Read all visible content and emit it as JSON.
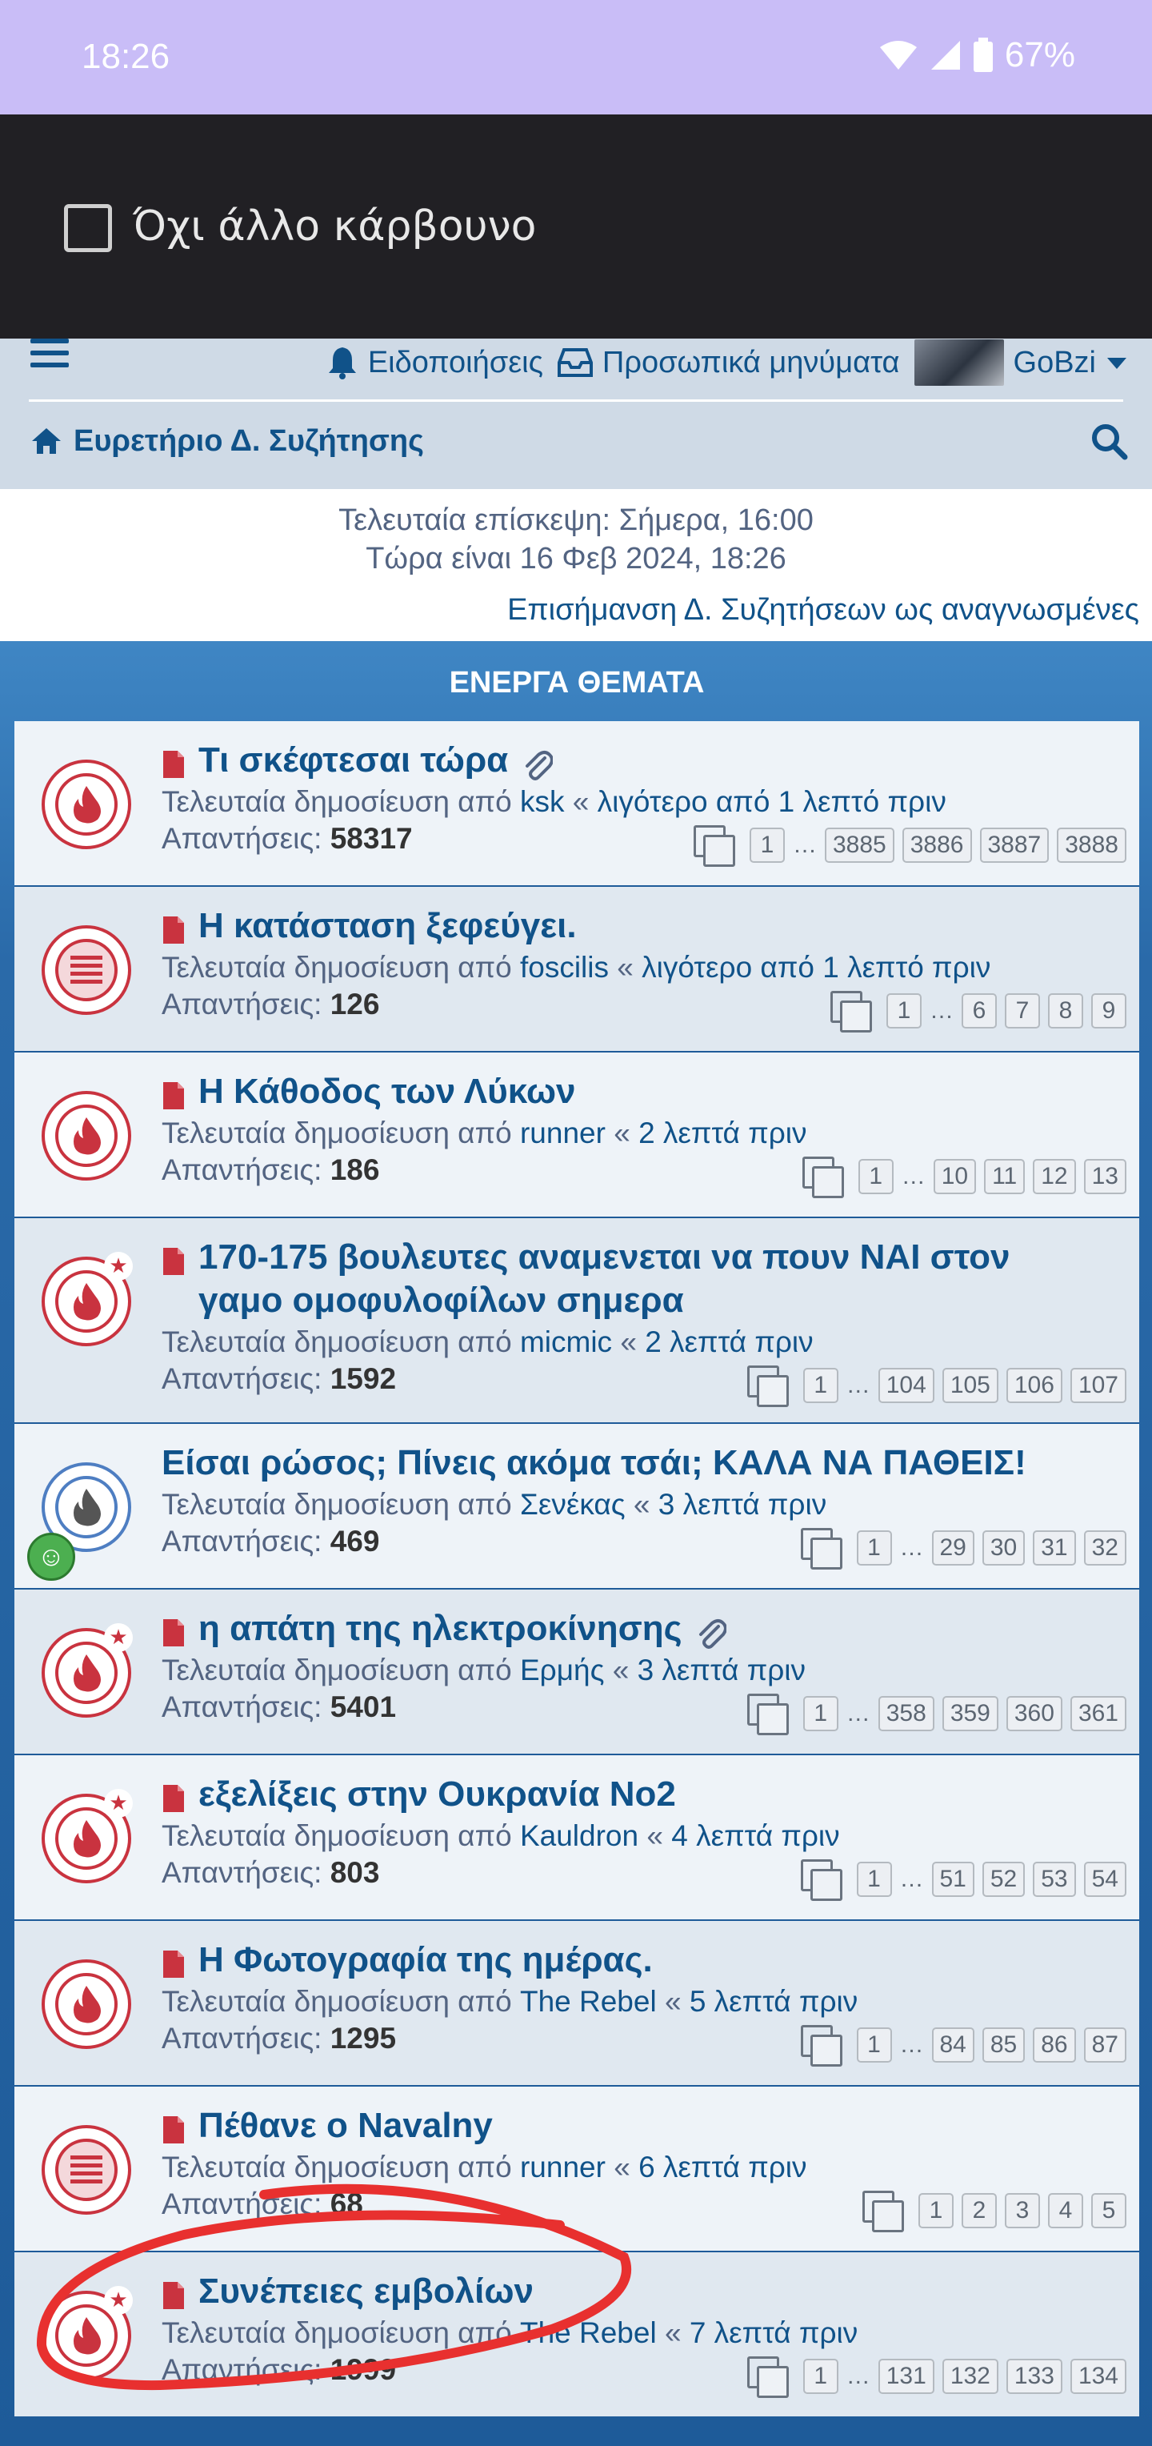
{
  "status_bar": {
    "time": "18:26",
    "battery": "67%",
    "icons": [
      "wifi-icon",
      "signal-icon",
      "battery-icon"
    ]
  },
  "top_banner": {
    "checkbox_label": "Όχι άλλο κάρβουνο",
    "checked": false
  },
  "nav": {
    "notifications": "Ειδοποιήσεις",
    "messages": "Προσωπικά μηνύματα",
    "username": "GoBzi",
    "breadcrumb": "Ευρετήριο Δ. Συζήτησης"
  },
  "info": {
    "last_visit": "Τελευταία επίσκεψη: Σήμερα, 16:00",
    "now": "Τώρα είναι 16 Φεβ 2024, 18:26",
    "mark_read": "Επισήμανση Δ. Συζητήσεων ως αναγνωσμένες"
  },
  "panel_title": "ΕΝΕΡΓΑ ΘΕΜΑΤΑ",
  "labels": {
    "last_post_by": "Τελευταία δημοσίευση από",
    "replies": "Απαντήσεις:"
  },
  "topics": [
    {
      "title": "Τι σκέφτεσαι τώρα",
      "attachment": true,
      "icon": "hot",
      "author": "ksk",
      "time": "λιγότερο από 1 λεπτό πριν",
      "replies": "58317",
      "pages": [
        "1",
        "…",
        "3885",
        "3886",
        "3887",
        "3888"
      ]
    },
    {
      "title": "Η κατάσταση ξεφεύγει.",
      "attachment": false,
      "icon": "list",
      "author": "foscilis",
      "time": "λιγότερο από 1 λεπτό πριν",
      "replies": "126",
      "pages": [
        "1",
        "…",
        "6",
        "7",
        "8",
        "9"
      ]
    },
    {
      "title": "Η Κάθοδος των Λύκων",
      "attachment": false,
      "icon": "hot",
      "author": "runner",
      "time": "2 λεπτά πριν",
      "replies": "186",
      "pages": [
        "1",
        "…",
        "10",
        "11",
        "12",
        "13"
      ]
    },
    {
      "title": "170-175 βουλευτες αναμενεται να πουν ΝΑΙ στον γαμο ομοφυλοφίλων σημερα",
      "attachment": false,
      "icon": "hot-star",
      "author": "micmic",
      "time": "2 λεπτά πριν",
      "replies": "1592",
      "pages": [
        "1",
        "…",
        "104",
        "105",
        "106",
        "107"
      ]
    },
    {
      "title": "Είσαι ρώσος; Πίνεις ακόμα τσάι; ΚΑΛΑ ΝΑ ΠΑΘΕΙΣ!",
      "attachment": false,
      "icon": "hot-blue",
      "author": "Σενέκας",
      "time": "3 λεπτά πριν",
      "replies": "469",
      "pages": [
        "1",
        "…",
        "29",
        "30",
        "31",
        "32"
      ]
    },
    {
      "title": "η απάτη της ηλεκτροκίνησης",
      "attachment": true,
      "icon": "hot-star",
      "author": "Ερμής",
      "time": "3 λεπτά πριν",
      "replies": "5401",
      "pages": [
        "1",
        "…",
        "358",
        "359",
        "360",
        "361"
      ]
    },
    {
      "title": "εξελίξεις στην Ουκρανία Νο2",
      "attachment": false,
      "icon": "hot-star",
      "author": "Kauldron",
      "time": "4 λεπτά πριν",
      "replies": "803",
      "pages": [
        "1",
        "…",
        "51",
        "52",
        "53",
        "54"
      ]
    },
    {
      "title": "Η Φωτογραφία της ημέρας.",
      "attachment": false,
      "icon": "hot",
      "author": "The Rebel",
      "time": "5 λεπτά πριν",
      "replies": "1295",
      "pages": [
        "1",
        "…",
        "84",
        "85",
        "86",
        "87"
      ]
    },
    {
      "title": "Πέθανε ο Navalny",
      "attachment": false,
      "icon": "list",
      "author": "runner",
      "time": "6 λεπτά πριν",
      "replies": "68",
      "pages": [
        "1",
        "2",
        "3",
        "4",
        "5"
      ]
    },
    {
      "title": "Συνέπειες εμβολίων",
      "attachment": false,
      "icon": "hot-star",
      "author": "The Rebel",
      "time": "7 λεπτά πριν",
      "replies": "1999",
      "pages": [
        "1",
        "…",
        "131",
        "132",
        "133",
        "134"
      ]
    }
  ],
  "colors": {
    "accent": "#105289",
    "hot": "#c9333f",
    "status_bar": "#c9bdf7",
    "panel": "#2a6aa9",
    "annotation": "#e8302f"
  }
}
